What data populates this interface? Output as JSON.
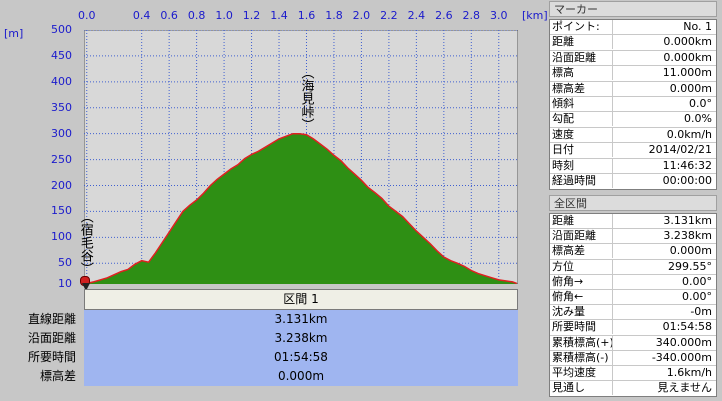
{
  "chart_data": {
    "type": "area",
    "x_unit": "[km]",
    "y_unit": "[m]",
    "xlim": [
      -0.02,
      3.14
    ],
    "ylim": [
      10,
      500
    ],
    "x_ticks": [
      "0.0",
      "0.4",
      "0.6",
      "0.8",
      "1.0",
      "1.2",
      "1.4",
      "1.6",
      "1.8",
      "2.0",
      "2.2",
      "2.4",
      "2.6",
      "2.8",
      "3.0"
    ],
    "x_tick_values": [
      0.0,
      0.4,
      0.6,
      0.8,
      1.0,
      1.2,
      1.4,
      1.6,
      1.8,
      2.0,
      2.2,
      2.4,
      2.6,
      2.8,
      3.0
    ],
    "y_ticks": [
      "500",
      "450",
      "400",
      "350",
      "300",
      "250",
      "200",
      "150",
      "100",
      "50",
      "10"
    ],
    "y_tick_values": [
      500,
      450,
      400,
      350,
      300,
      250,
      200,
      150,
      100,
      50,
      10
    ],
    "grid": true,
    "fill_color": "#2e8f14",
    "line_color": "#e02020",
    "plot_bg": "#d8d8d8",
    "grid_color": "#4060d0",
    "annotations": [
      {
        "text": "（海見峠）",
        "x": 1.6
      },
      {
        "text": "（宿毛谷）",
        "x": 0.0
      }
    ],
    "x": [
      0.0,
      0.05,
      0.1,
      0.15,
      0.2,
      0.25,
      0.3,
      0.35,
      0.4,
      0.45,
      0.5,
      0.55,
      0.6,
      0.65,
      0.7,
      0.75,
      0.8,
      0.85,
      0.9,
      0.95,
      1.0,
      1.05,
      1.1,
      1.15,
      1.2,
      1.25,
      1.3,
      1.35,
      1.4,
      1.45,
      1.5,
      1.55,
      1.6,
      1.65,
      1.7,
      1.75,
      1.8,
      1.85,
      1.9,
      1.95,
      2.0,
      2.05,
      2.1,
      2.15,
      2.2,
      2.25,
      2.3,
      2.35,
      2.4,
      2.45,
      2.5,
      2.55,
      2.6,
      2.65,
      2.7,
      2.75,
      2.8,
      2.85,
      2.9,
      2.95,
      3.0,
      3.05,
      3.1,
      3.131
    ],
    "y": [
      11,
      14,
      18,
      22,
      28,
      34,
      38,
      48,
      55,
      52,
      70,
      90,
      110,
      130,
      150,
      162,
      172,
      185,
      200,
      212,
      222,
      232,
      240,
      252,
      260,
      266,
      274,
      282,
      290,
      295,
      300,
      300,
      298,
      290,
      280,
      270,
      258,
      248,
      234,
      222,
      210,
      196,
      186,
      175,
      160,
      150,
      140,
      126,
      112,
      100,
      88,
      74,
      62,
      55,
      50,
      44,
      36,
      30,
      26,
      22,
      18,
      16,
      14,
      11
    ]
  },
  "section_panel": {
    "header": "区間 1",
    "rows": [
      {
        "label": "直線距離",
        "value": "3.131km"
      },
      {
        "label": "沿面距離",
        "value": "3.238km"
      },
      {
        "label": "所要時間",
        "value": "01:54:58"
      },
      {
        "label": "標高差",
        "value": "0.000m"
      }
    ]
  },
  "marker_panel": {
    "title": "マーカー",
    "rows": [
      {
        "label": "ポイント:",
        "value": "No. 1"
      },
      {
        "label": "距離",
        "value": "0.000km"
      },
      {
        "label": "沿面距離",
        "value": "0.000km"
      },
      {
        "label": "標高",
        "value": "11.000m"
      },
      {
        "label": "標高差",
        "value": "0.000m"
      },
      {
        "label": "傾斜",
        "value": "0.0°"
      },
      {
        "label": "勾配",
        "value": "0.0%"
      },
      {
        "label": "速度",
        "value": "0.0km/h"
      },
      {
        "label": "日付",
        "value": "2014/02/21"
      },
      {
        "label": "時刻",
        "value": "11:46:32"
      },
      {
        "label": "経過時間",
        "value": "00:00:00"
      }
    ]
  },
  "all_panel": {
    "title": "全区間",
    "rows": [
      {
        "label": "距離",
        "value": "3.131km"
      },
      {
        "label": "沿面距離",
        "value": "3.238km"
      },
      {
        "label": "標高差",
        "value": "0.000m"
      },
      {
        "label": "方位",
        "value": "299.55°"
      },
      {
        "label": "俯角→",
        "value": "0.00°"
      },
      {
        "label": "俯角←",
        "value": "0.00°"
      },
      {
        "label": "沈み量",
        "value": "-0m"
      },
      {
        "label": "所要時間",
        "value": "01:54:58"
      },
      {
        "label": "累積標高(+)",
        "value": "340.000m"
      },
      {
        "label": "累積標高(-)",
        "value": "-340.000m"
      },
      {
        "label": "平均速度",
        "value": "1.6km/h"
      },
      {
        "label": "見通し",
        "value": "見えません"
      }
    ]
  }
}
